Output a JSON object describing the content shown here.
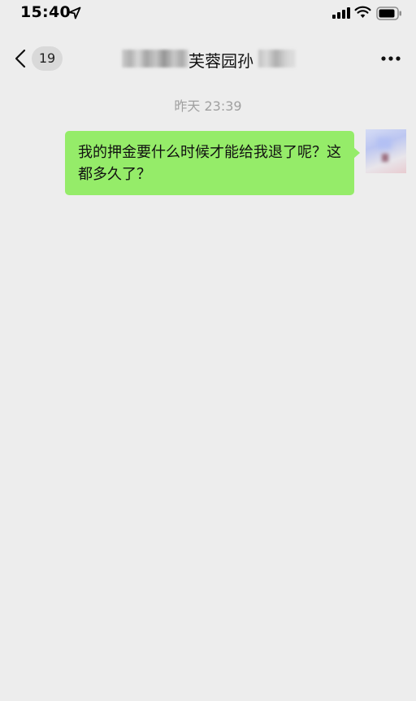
{
  "status_bar": {
    "time": "15:40",
    "icons": [
      "location-arrow-icon",
      "cellular-signal-icon",
      "wifi-icon",
      "battery-icon"
    ]
  },
  "nav": {
    "back_icon": "chevron-left-icon",
    "unread_count": "19",
    "title_visible": "芙蓉园孙",
    "more_icon": "more-dots-icon"
  },
  "chat": {
    "timestamp": "昨天 23:39",
    "messages": [
      {
        "sender": "self",
        "text": "我的押金要什么时候才能给我退了呢？这都多久了？",
        "bubble_color": "#95ec69"
      }
    ]
  },
  "colors": {
    "background": "#ededed",
    "bubble": "#95ec69",
    "badge": "#d9d9d9",
    "timestamp_text": "#a0a0a0"
  }
}
